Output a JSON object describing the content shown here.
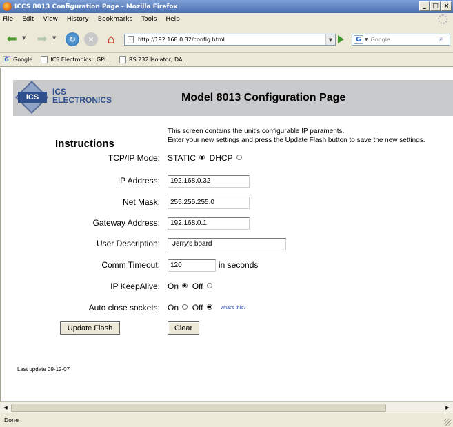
{
  "window": {
    "title": "ICCS 8013 Configuration Page - Mozilla Firefox",
    "buttons": [
      "_",
      "□",
      "×"
    ]
  },
  "menu": [
    "File",
    "Edit",
    "View",
    "History",
    "Bookmarks",
    "Tools",
    "Help"
  ],
  "nav": {
    "url": "http://192.168.0.32/config.html",
    "search_placeholder": "Google",
    "search_engine_letter": "G",
    "icons": [
      "back-arrow-icon",
      "forward-arrow-icon",
      "reload-icon",
      "stop-icon",
      "home-icon",
      "go-icon",
      "search-icon"
    ]
  },
  "bookmarks": [
    {
      "label": "Google",
      "icon": "google-icon"
    },
    {
      "label": "ICS Electronics ..GPI...",
      "icon": "page-icon"
    },
    {
      "label": "RS 232 Isolator, DA...",
      "icon": "page-icon"
    }
  ],
  "page": {
    "logo": {
      "badge": "ICS",
      "line1": "ICS",
      "line2": "ELECTRONICS"
    },
    "title": "Model 8013 Configuration Page",
    "instructions_heading": "Instructions",
    "intro_line1": "This screen contains the unit's configurable IP paraments.",
    "intro_line2": "Enter your new settings and press the Update Flash button to save the new settings.",
    "tcpip": {
      "label": "TCP/IP Mode:",
      "opt1": "STATIC",
      "opt2": "DHCP",
      "selected": "STATIC"
    },
    "ip": {
      "label": "IP Address:",
      "value": "192.168.0.32"
    },
    "mask": {
      "label": "Net Mask:",
      "value": "255.255.255.0"
    },
    "gateway": {
      "label": "Gateway Address:",
      "value": "192.168.0.1"
    },
    "desc": {
      "label": "User Description:",
      "value": "Jerry's board"
    },
    "timeout": {
      "label": "Comm Timeout:",
      "value": "120",
      "unit": "in seconds"
    },
    "keepalive": {
      "label": "IP KeepAlive:",
      "opt1": "On",
      "opt2": "Off",
      "selected": "On"
    },
    "autoclose": {
      "label": "Auto close sockets:",
      "opt1": "On",
      "opt2": "Off",
      "selected": "Off",
      "help_link": "what's this?"
    },
    "update_button": "Update Flash",
    "clear_button": "Clear",
    "last_update": "Last update 09-12-07"
  },
  "status": {
    "text": "Done"
  }
}
